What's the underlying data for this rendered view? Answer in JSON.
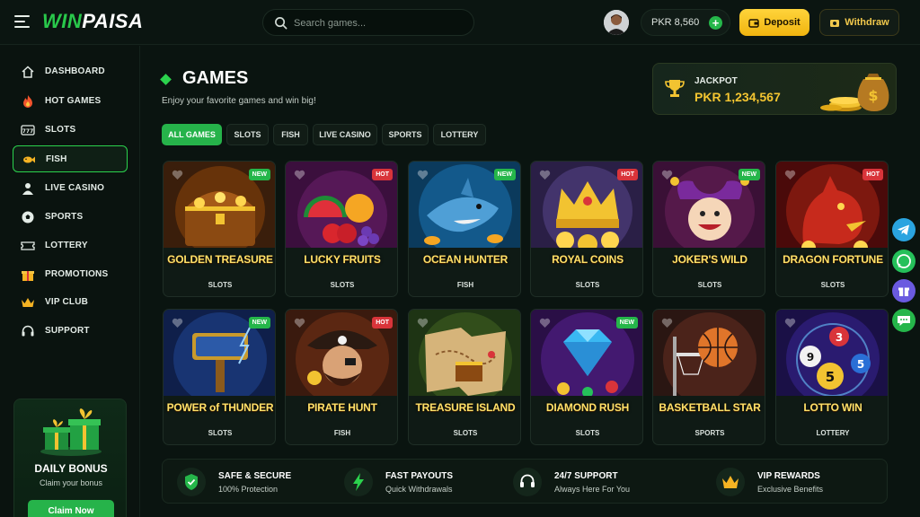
{
  "header": {
    "logo_part1": "WIN",
    "logo_part2": "PAISA",
    "search_placeholder": "Search games...",
    "balance": "PKR 8,560",
    "deposit_label": "Deposit",
    "withdraw_label": "Withdraw"
  },
  "sidebar": {
    "items": [
      {
        "label": "DASHBOARD",
        "icon": "home-icon"
      },
      {
        "label": "HOT GAMES",
        "icon": "fire-icon"
      },
      {
        "label": "SLOTS",
        "icon": "slot-machine-icon"
      },
      {
        "label": "FISH",
        "icon": "fish-icon",
        "active": true
      },
      {
        "label": "LIVE CASINO",
        "icon": "dealer-icon"
      },
      {
        "label": "SPORTS",
        "icon": "soccer-ball-icon"
      },
      {
        "label": "LOTTERY",
        "icon": "ticket-icon"
      },
      {
        "label": "PROMOTIONS",
        "icon": "gift-icon"
      },
      {
        "label": "VIP CLUB",
        "icon": "crown-icon"
      },
      {
        "label": "SUPPORT",
        "icon": "headset-icon"
      }
    ],
    "bonus": {
      "title": "DAILY BONUS",
      "subtitle": "Claim your bonus",
      "button": "Claim Now"
    }
  },
  "main": {
    "title": "GAMES",
    "subtitle": "Enjoy your favorite games and win big!",
    "filters": [
      "ALL GAMES",
      "SLOTS",
      "FISH",
      "LIVE CASINO",
      "SPORTS",
      "LOTTERY"
    ],
    "active_filter": "ALL GAMES"
  },
  "jackpot": {
    "label": "JACKPOT",
    "value": "PKR 1,234,567"
  },
  "games": [
    {
      "name": "GOLDEN TREASURE",
      "category": "SLOTS",
      "badge": "NEW"
    },
    {
      "name": "LUCKY FRUITS",
      "category": "SLOTS",
      "badge": "HOT"
    },
    {
      "name": "OCEAN HUNTER",
      "category": "FISH",
      "badge": "NEW"
    },
    {
      "name": "ROYAL COINS",
      "category": "SLOTS",
      "badge": "HOT"
    },
    {
      "name": "JOKER'S WILD",
      "category": "SLOTS",
      "badge": "NEW"
    },
    {
      "name": "DRAGON FORTUNE",
      "category": "SLOTS",
      "badge": "HOT"
    },
    {
      "name": "POWER of THUNDER",
      "category": "SLOTS",
      "badge": "NEW"
    },
    {
      "name": "PIRATE HUNT",
      "category": "FISH",
      "badge": "HOT"
    },
    {
      "name": "TREASURE ISLAND",
      "category": "SLOTS",
      "badge": ""
    },
    {
      "name": "DIAMOND RUSH",
      "category": "SLOTS",
      "badge": "NEW"
    },
    {
      "name": "BASKETBALL STAR",
      "category": "SPORTS",
      "badge": ""
    },
    {
      "name": "LOTTO WIN",
      "category": "LOTTERY",
      "badge": ""
    }
  ],
  "features": [
    {
      "title": "SAFE & SECURE",
      "subtitle": "100% Protection",
      "icon": "shield-icon"
    },
    {
      "title": "FAST PAYOUTS",
      "subtitle": "Quick Withdrawals",
      "icon": "lightning-icon"
    },
    {
      "title": "24/7 SUPPORT",
      "subtitle": "Always Here For You",
      "icon": "headset-icon"
    },
    {
      "title": "VIP REWARDS",
      "subtitle": "Exclusive Benefits",
      "icon": "crown-icon"
    }
  ],
  "social": [
    {
      "icon": "telegram-icon",
      "color": "#2aa4e0"
    },
    {
      "icon": "whatsapp-icon",
      "color": "#25c05a"
    },
    {
      "icon": "gift-icon",
      "color": "#6a5ae0"
    },
    {
      "icon": "chat-icon",
      "color": "#25b64a"
    }
  ]
}
